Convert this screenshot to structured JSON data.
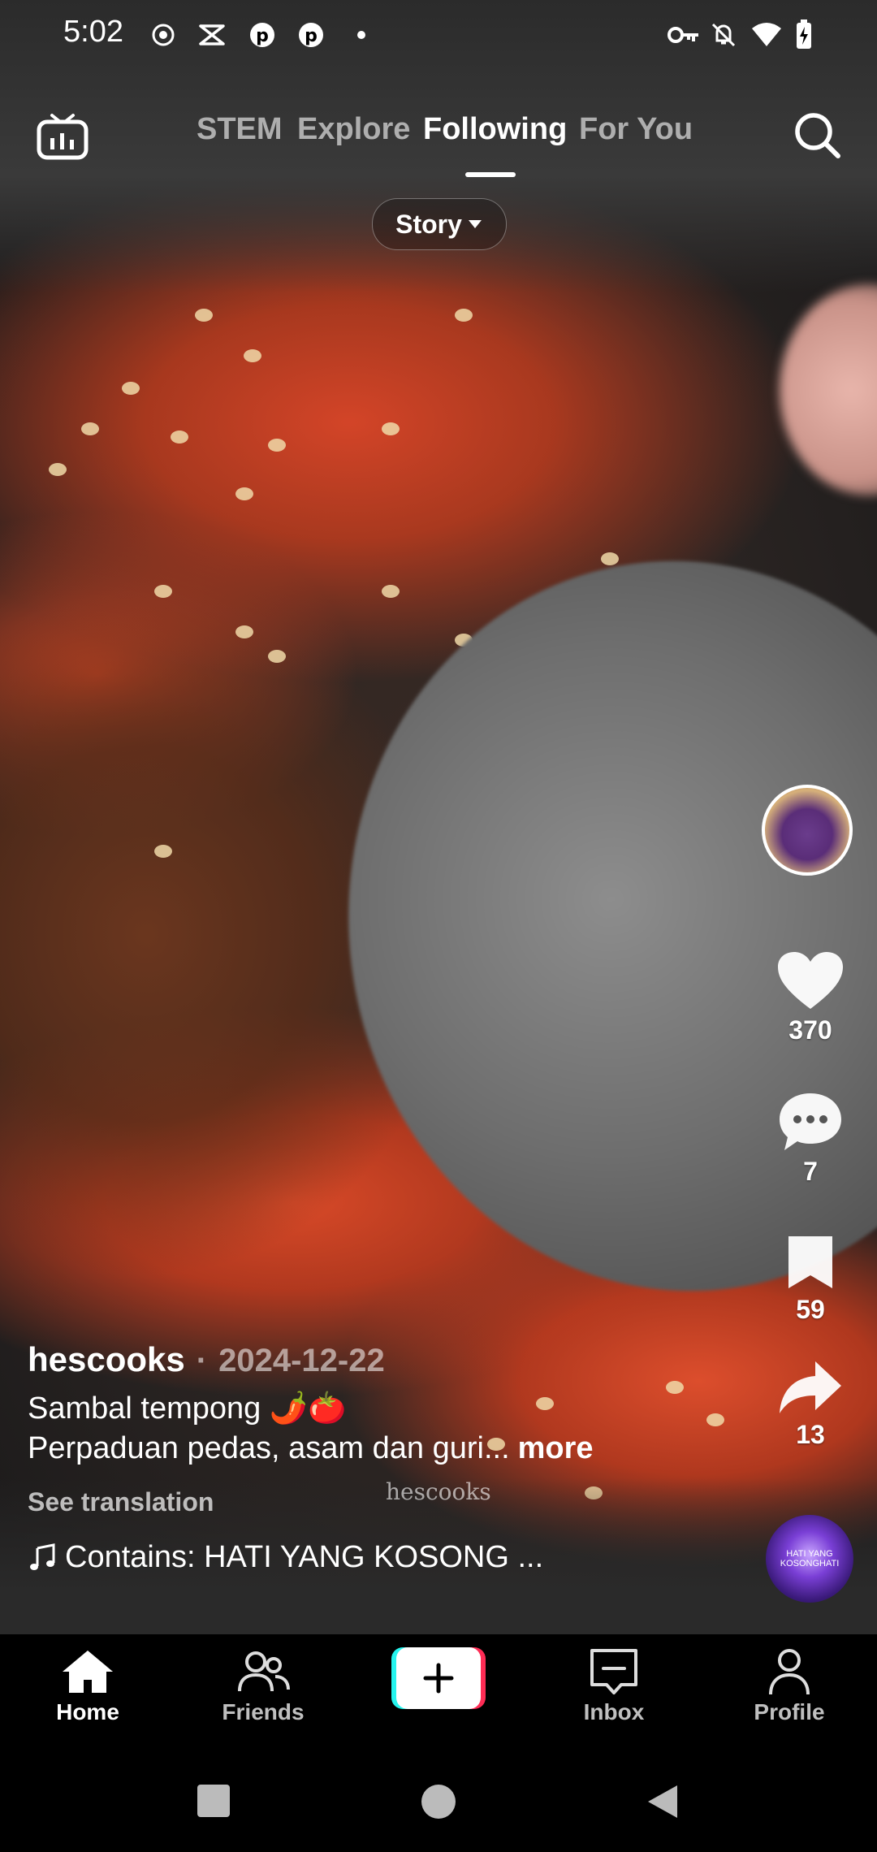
{
  "status_bar": {
    "time": "5:02"
  },
  "top_nav": {
    "tabs": [
      {
        "label": "STEM",
        "active": false
      },
      {
        "label": "Explore",
        "active": false
      },
      {
        "label": "Following",
        "active": true
      },
      {
        "label": "For You",
        "active": false
      }
    ],
    "story_chip": "Story"
  },
  "rail": {
    "like_count": "370",
    "comment_count": "7",
    "bookmark_count": "59",
    "share_count": "13"
  },
  "music_disc_text": "HATI YANG KOSONGHATI",
  "caption": {
    "author": "hescooks",
    "separator": "·",
    "date": "2024-12-22",
    "title_line": "Sambal tempong 🌶️🍅",
    "desc_line": "Perpaduan pedas, asam dan guri...",
    "more": "more",
    "see_translation": "See translation",
    "sound": "Contains: HATI YANG KOSONG ...",
    "watermark": "hescooks"
  },
  "bottom_nav": {
    "items": [
      {
        "label": "Home",
        "active": true
      },
      {
        "label": "Friends",
        "active": false
      },
      {
        "label": "Inbox",
        "active": false
      },
      {
        "label": "Profile",
        "active": false
      }
    ]
  },
  "colors": {
    "accent_cyan": "#25f4ee",
    "accent_pink": "#fe2c55",
    "nav_bg": "#000000"
  }
}
